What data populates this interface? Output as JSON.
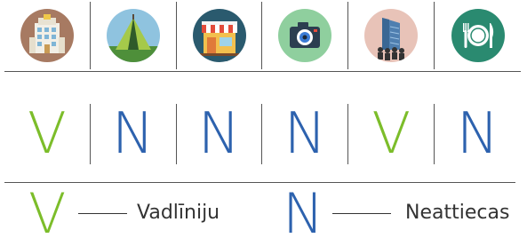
{
  "colors": {
    "green": "#7cbd2a",
    "blue": "#2d62ae",
    "line": "#555555"
  },
  "icons": [
    {
      "name": "apartment-building-icon",
      "bg": "#a77a62"
    },
    {
      "name": "camping-tent-icon",
      "bg": "#8fc3df"
    },
    {
      "name": "shop-storefront-icon",
      "bg": "#2a5a6e"
    },
    {
      "name": "camera-icon",
      "bg": "#8fcf9e"
    },
    {
      "name": "office-tower-people-icon",
      "bg": "#e8c3b8"
    },
    {
      "name": "restaurant-plate-icon",
      "bg": "#2a8a70"
    }
  ],
  "letters": [
    {
      "text": "V",
      "kind": "green"
    },
    {
      "text": "N",
      "kind": "blue"
    },
    {
      "text": "N",
      "kind": "blue"
    },
    {
      "text": "N",
      "kind": "blue"
    },
    {
      "text": "V",
      "kind": "green"
    },
    {
      "text": "N",
      "kind": "blue"
    }
  ],
  "legend": {
    "v_letter": "V",
    "v_label": "Vadlīniju",
    "n_letter": "N",
    "n_label": "Neattiecas"
  }
}
